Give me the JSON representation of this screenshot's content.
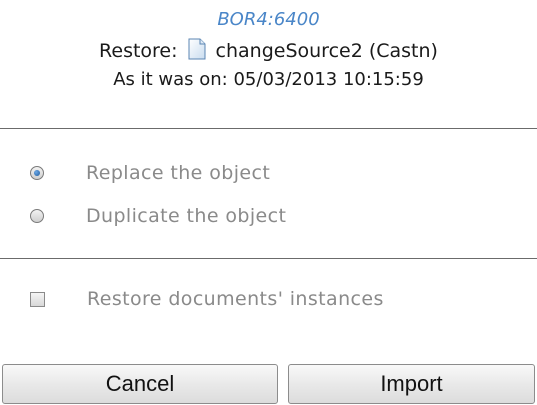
{
  "header": {
    "ref_id": "BOR4:6400",
    "restore_label": "Restore:",
    "object_name": "changeSource2 (Castn)",
    "as_of": "As it was on: 05/03/2013 10:15:59",
    "object_icon": "document-icon"
  },
  "options": {
    "replace_label": "Replace the object",
    "duplicate_label": "Duplicate the object",
    "selected": "replace"
  },
  "instances": {
    "label": "Restore documents' instances",
    "checked": false
  },
  "buttons": {
    "cancel_label": "Cancel",
    "import_label": "Import"
  },
  "colors": {
    "ref_id": "#4a86c8",
    "disabled_text": "#8a8a8a",
    "radio_selected": "#1f5c9e"
  }
}
